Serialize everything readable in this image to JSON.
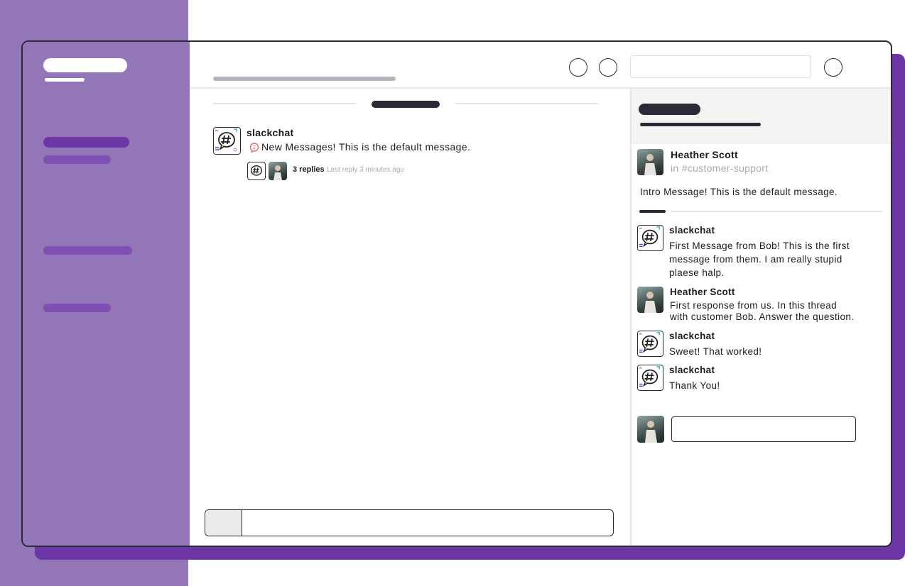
{
  "colors": {
    "accent": "#6e35a5",
    "sidebar": "#9276b8",
    "ink": "#2b2a38"
  },
  "channel_feed": {
    "message": {
      "author": "slackchat",
      "text": "New Messages! This is the default message.",
      "icon": "speech-bubble-icon",
      "replies_label": "3 replies",
      "last_reply": "Last reply 3 minutes ago"
    }
  },
  "thread": {
    "parent": {
      "author": "Heather Scott",
      "channel": "in #customer-support",
      "text": "Intro Message! This is the default message."
    },
    "replies": [
      {
        "author": "slackchat",
        "lines": [
          "First Message from Bob! This is the first",
          "message from them. I am really stupid",
          "plaese halp."
        ]
      },
      {
        "author": "Heather Scott",
        "lines": [
          "First response from us. In this thread",
          "with customer Bob. Answer the question."
        ]
      },
      {
        "author": "slackchat",
        "lines": [
          "Sweet! That worked!"
        ]
      },
      {
        "author": "slackchat",
        "lines": [
          "Thank You!"
        ]
      }
    ]
  }
}
